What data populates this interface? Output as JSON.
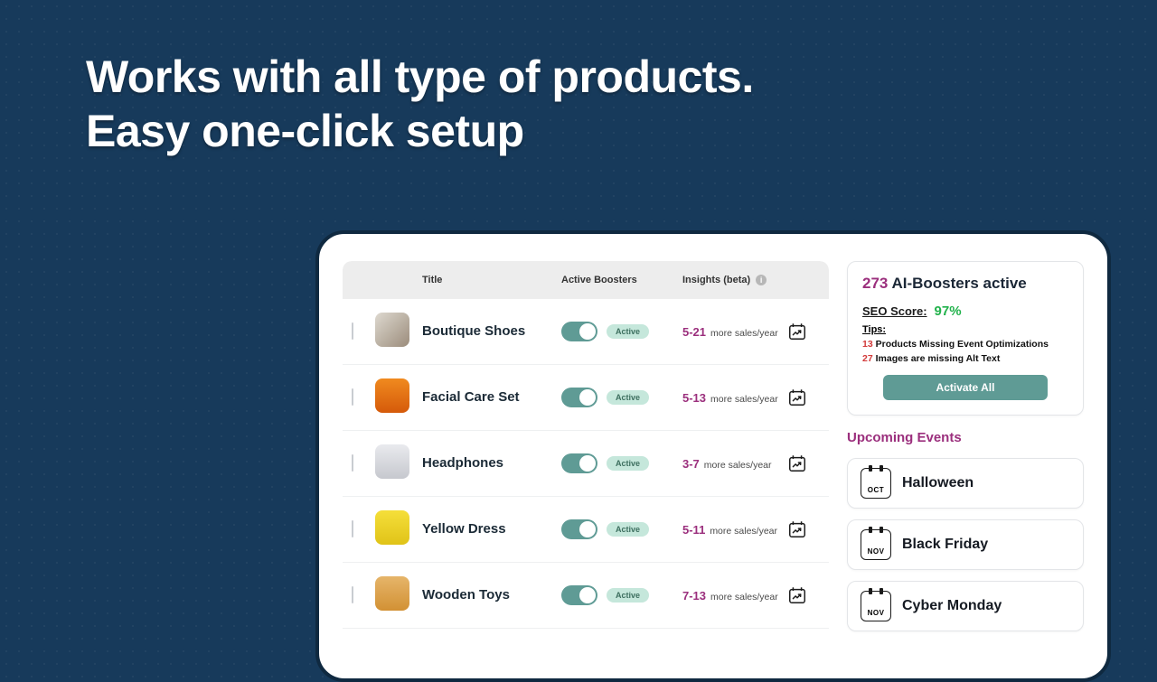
{
  "headline": {
    "line1": "Works with all type of products.",
    "line2": "Easy one-click setup"
  },
  "table": {
    "headers": {
      "title": "Title",
      "boosters": "Active Boosters",
      "insights": "Insights (beta)"
    },
    "active_label": "Active",
    "more_sales_label": "more sales/year",
    "rows": [
      {
        "name": "Boutique Shoes",
        "range": "5-21",
        "thumb": "th-shoes"
      },
      {
        "name": "Facial Care Set",
        "range": "5-13",
        "thumb": "th-facial"
      },
      {
        "name": "Headphones",
        "range": "3-7",
        "thumb": "th-head"
      },
      {
        "name": "Yellow Dress",
        "range": "5-11",
        "thumb": "th-dress"
      },
      {
        "name": "Wooden Toys",
        "range": "7-13",
        "thumb": "th-toys"
      }
    ]
  },
  "side": {
    "boosters_count": "273",
    "boosters_label": "AI-Boosters active",
    "seo_label": "SEO Score:",
    "seo_value": "97%",
    "tips_label": "Tips:",
    "tip1_num": "13",
    "tip1_txt": "Products Missing Event Optimizations",
    "tip2_num": "27",
    "tip2_txt": "Images are missing Alt Text",
    "activate_label": "Activate All",
    "events_header": "Upcoming Events",
    "events": [
      {
        "month": "OCT",
        "name": "Halloween"
      },
      {
        "month": "NOV",
        "name": "Black Friday"
      },
      {
        "month": "NOV",
        "name": "Cyber Monday"
      }
    ]
  }
}
